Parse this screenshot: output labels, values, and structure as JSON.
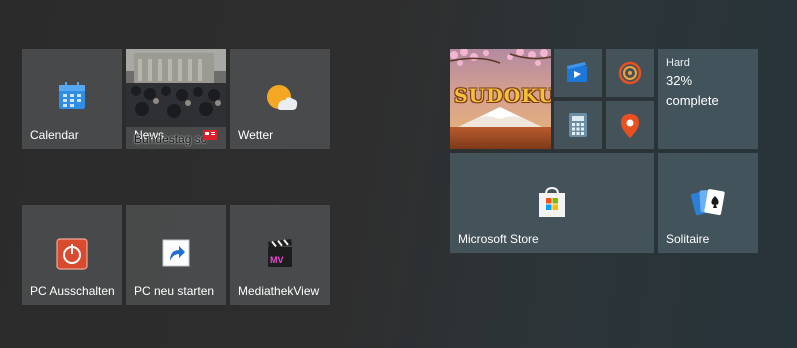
{
  "left_group": {
    "tiles": [
      {
        "label": "Calendar",
        "icon": "calendar-icon"
      },
      {
        "label": "News",
        "headline": "Bundestag sc",
        "icon": "news-icon"
      },
      {
        "label": "Wetter",
        "icon": "weather-icon"
      },
      {
        "label": "PC Ausschalten",
        "icon": "power-icon"
      },
      {
        "label": "PC neu starten",
        "icon": "shortcut-arrow-icon"
      },
      {
        "label": "MediathekView",
        "icon": "clapperboard-icon",
        "icon_text": "MV"
      }
    ]
  },
  "right_group": {
    "sudoku": {
      "title": "SUDOKU"
    },
    "small_tiles": [
      {
        "icon": "movies-tv-icon"
      },
      {
        "icon": "groove-music-icon"
      },
      {
        "icon": "calculator-icon"
      },
      {
        "icon": "maps-pin-icon"
      }
    ],
    "progress_tile": {
      "level": "Hard",
      "percent": "32%",
      "status": "complete"
    },
    "store": {
      "label": "Microsoft Store",
      "icon": "store-bag-icon"
    },
    "solitaire": {
      "label": "Solitaire",
      "icon": "cards-icon"
    }
  },
  "colors": {
    "accent": "#2a8ee8",
    "weather_sun": "#f5a623",
    "power_red": "#d84b2f",
    "maps_orange": "#e9501f"
  }
}
